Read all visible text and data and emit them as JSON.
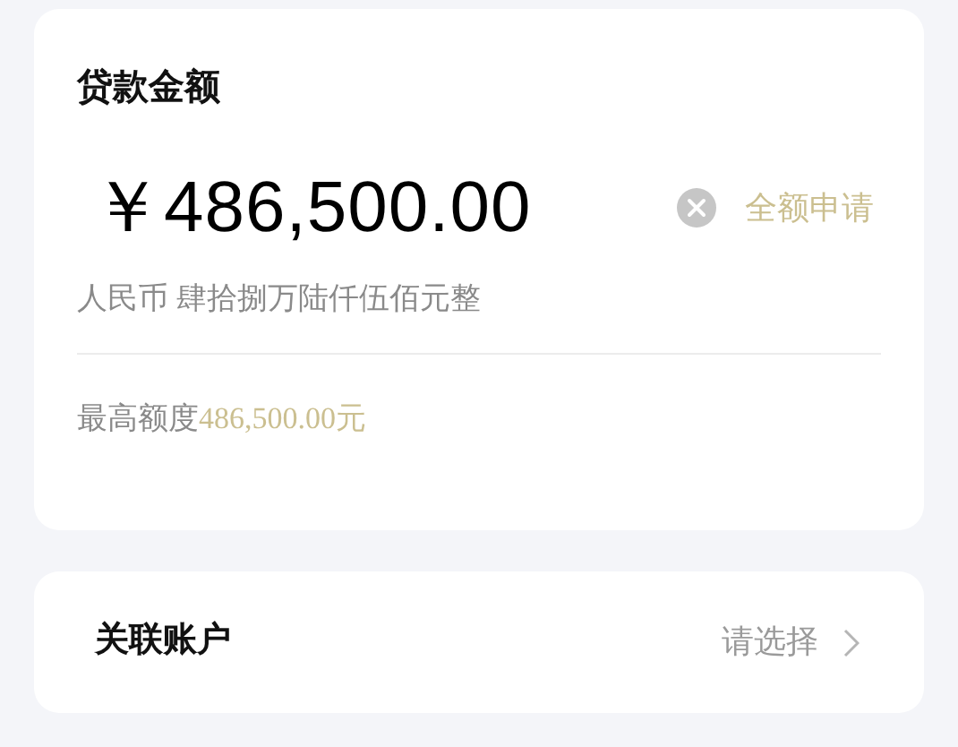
{
  "loan_card": {
    "title": "贷款金额",
    "amount_field": {
      "value": "￥486,500.00"
    },
    "full_amount_link": "全额申请",
    "amount_in_words": "人民币 肆拾捌万陆仟伍佰元整",
    "max_label": "最高额度",
    "max_value": "486,500.00元"
  },
  "account_row": {
    "label": "关联账户",
    "placeholder": "请选择"
  }
}
